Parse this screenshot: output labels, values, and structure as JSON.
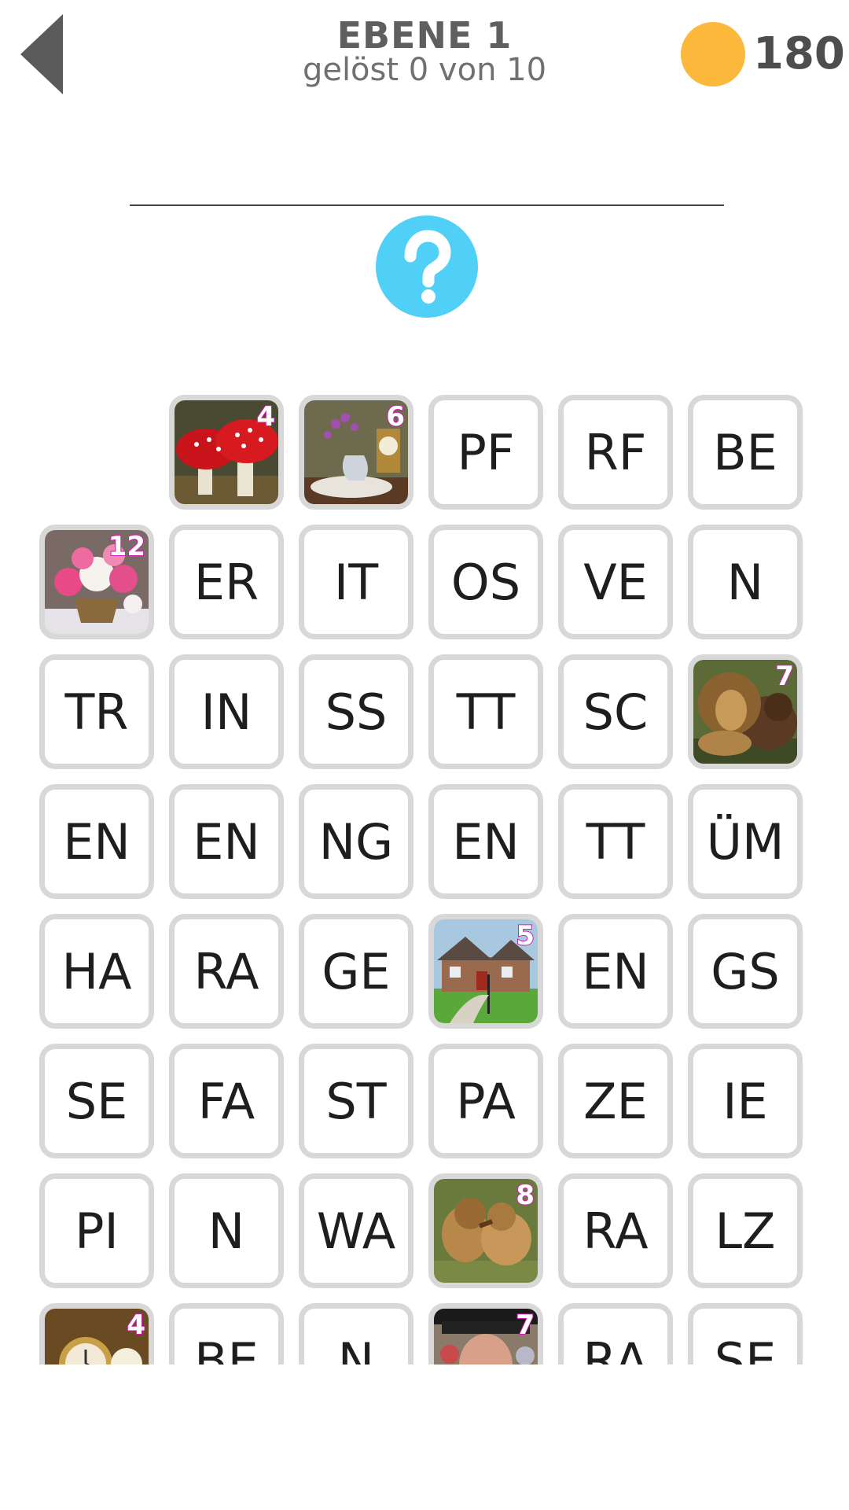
{
  "header": {
    "level_title": "EBENE 1",
    "progress_text": "gelöst 0 von 10",
    "coins": "180"
  },
  "colors": {
    "coin": "#fcb83a",
    "hint_button": "#50d0f6",
    "tile_border": "#d8d8d8",
    "picture_count_outline": "#d21bb4"
  },
  "icons": {
    "back": "back-arrow-icon",
    "coin": "coin-icon",
    "hint": "question-mark-icon"
  },
  "board": {
    "rows": [
      [
        {
          "type": "empty"
        },
        {
          "type": "picture",
          "subject": "mushrooms",
          "count": "4"
        },
        {
          "type": "picture",
          "subject": "still-life-clock-flowers",
          "count": "6"
        },
        {
          "type": "text",
          "text": "PF"
        },
        {
          "type": "text",
          "text": "RF"
        },
        {
          "type": "text",
          "text": "BE"
        }
      ],
      [
        {
          "type": "picture",
          "subject": "peony-bouquet",
          "count": "12"
        },
        {
          "type": "text",
          "text": "ER"
        },
        {
          "type": "text",
          "text": "IT"
        },
        {
          "type": "text",
          "text": "OS"
        },
        {
          "type": "text",
          "text": "VE"
        },
        {
          "type": "text",
          "text": "N"
        }
      ],
      [
        {
          "type": "text",
          "text": "TR"
        },
        {
          "type": "text",
          "text": "IN"
        },
        {
          "type": "text",
          "text": "SS"
        },
        {
          "type": "text",
          "text": "TT"
        },
        {
          "type": "text",
          "text": "SC"
        },
        {
          "type": "picture",
          "subject": "lion-and-bear",
          "count": "7"
        }
      ],
      [
        {
          "type": "text",
          "text": "EN"
        },
        {
          "type": "text",
          "text": "EN"
        },
        {
          "type": "text",
          "text": "NG"
        },
        {
          "type": "text",
          "text": "EN"
        },
        {
          "type": "text",
          "text": "TT"
        },
        {
          "type": "text",
          "text": "ÜM"
        }
      ],
      [
        {
          "type": "text",
          "text": "HA"
        },
        {
          "type": "text",
          "text": "RA"
        },
        {
          "type": "text",
          "text": "GE"
        },
        {
          "type": "picture",
          "subject": "house",
          "count": "5"
        },
        {
          "type": "text",
          "text": "EN"
        },
        {
          "type": "text",
          "text": "GS"
        }
      ],
      [
        {
          "type": "text",
          "text": "SE"
        },
        {
          "type": "text",
          "text": "FA"
        },
        {
          "type": "text",
          "text": "ST"
        },
        {
          "type": "text",
          "text": "PA"
        },
        {
          "type": "text",
          "text": "ZE"
        },
        {
          "type": "text",
          "text": "IE"
        }
      ],
      [
        {
          "type": "text",
          "text": "PI"
        },
        {
          "type": "text",
          "text": "N"
        },
        {
          "type": "text",
          "text": "WA"
        },
        {
          "type": "picture",
          "subject": "fighting-lions",
          "count": "8"
        },
        {
          "type": "text",
          "text": "RA"
        },
        {
          "type": "text",
          "text": "LZ"
        }
      ],
      [
        {
          "type": "picture",
          "subject": "pocket-watch",
          "count": "4"
        },
        {
          "type": "text",
          "text": "BE"
        },
        {
          "type": "text",
          "text": "N"
        },
        {
          "type": "picture",
          "subject": "old-man-portrait",
          "count": "7"
        },
        {
          "type": "text",
          "text": "RA"
        },
        {
          "type": "text",
          "text": "SE"
        }
      ]
    ]
  }
}
